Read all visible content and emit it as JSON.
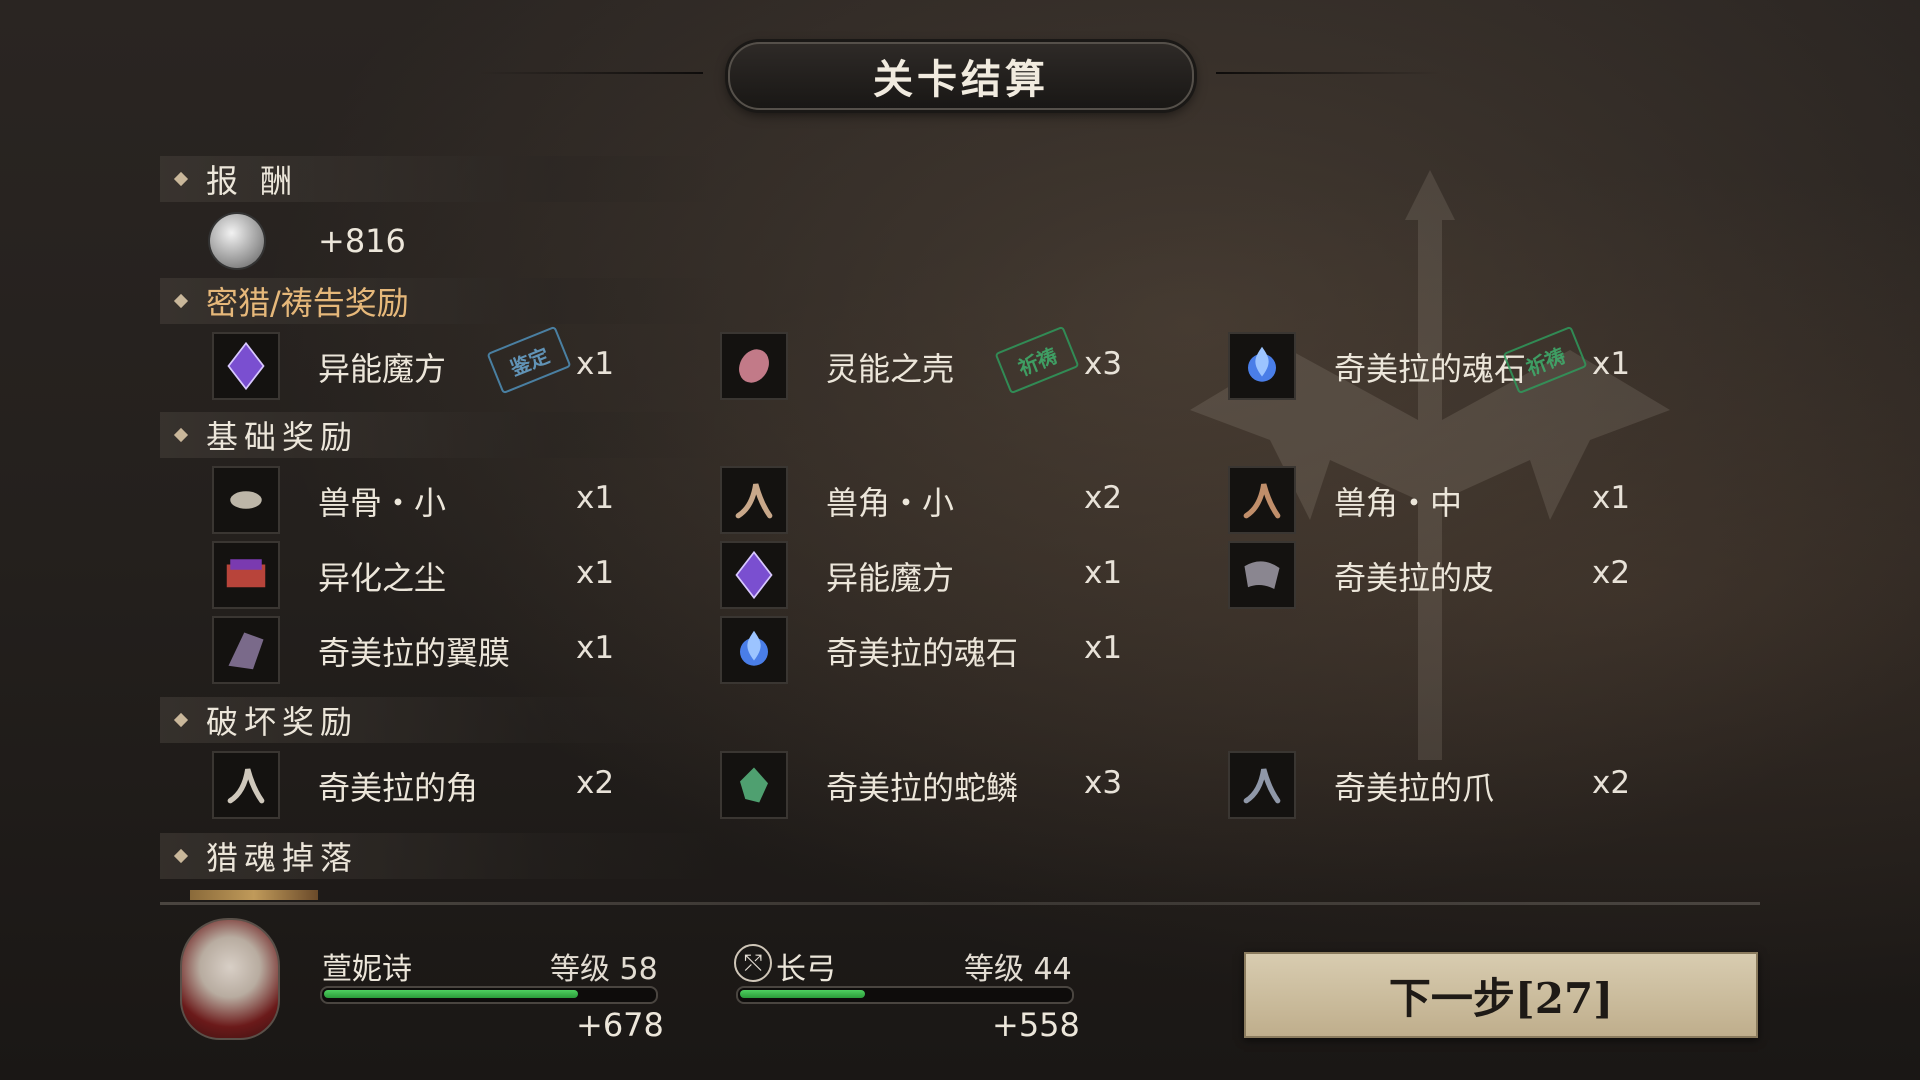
{
  "title": "关卡结算",
  "sections": {
    "reward": {
      "title": "报 酬",
      "coin": "+816"
    },
    "hunt_prayer": {
      "title": "密猎/祷告奖励",
      "items": [
        {
          "name": "异能魔方",
          "qty": "x1",
          "stamp": "鉴定",
          "icon": "purple-crystal-icon",
          "color": "#7a4fd0"
        },
        {
          "name": "灵能之壳",
          "qty": "x3",
          "stamp": "祈祷",
          "icon": "psychic-shell-icon",
          "color": "#c27a88"
        },
        {
          "name": "奇美拉的魂石",
          "qty": "x1",
          "stamp": "祈祷",
          "icon": "blue-soul-stone-icon",
          "color": "#4a7ee8"
        }
      ]
    },
    "basic": {
      "title": "基础奖励",
      "items": [
        {
          "name": "兽骨・小",
          "qty": "x1",
          "icon": "beast-bone-icon",
          "color": "#bdb6a8"
        },
        {
          "name": "兽角・小",
          "qty": "x2",
          "icon": "small-horn-icon",
          "color": "#c9a88a"
        },
        {
          "name": "兽角・中",
          "qty": "x1",
          "icon": "medium-horn-icon",
          "color": "#c08e6a"
        },
        {
          "name": "异化之尘",
          "qty": "x1",
          "icon": "mutation-dust-chest-icon",
          "color": "#b8443a"
        },
        {
          "name": "异能魔方",
          "qty": "x1",
          "icon": "purple-crystal-icon",
          "color": "#7a4fd0"
        },
        {
          "name": "奇美拉的皮",
          "qty": "x2",
          "icon": "chimera-hide-icon",
          "color": "#8a8690"
        },
        {
          "name": "奇美拉的翼膜",
          "qty": "x1",
          "icon": "chimera-wing-icon",
          "color": "#7a6a8a"
        },
        {
          "name": "奇美拉的魂石",
          "qty": "x1",
          "icon": "blue-soul-stone-icon",
          "color": "#4a7ee8"
        }
      ]
    },
    "destruction": {
      "title": "破坏奖励",
      "items": [
        {
          "name": "奇美拉的角",
          "qty": "x2",
          "icon": "chimera-horn-icon",
          "color": "#cfc8bc"
        },
        {
          "name": "奇美拉的蛇鳞",
          "qty": "x3",
          "icon": "chimera-scale-icon",
          "color": "#4fa070"
        },
        {
          "name": "奇美拉的爪",
          "qty": "x2",
          "icon": "chimera-claw-icon",
          "color": "#8f97a8"
        }
      ]
    },
    "soul_drop": {
      "title": "猎魂掉落"
    }
  },
  "character": {
    "name": "萱妮诗",
    "level": "等级 58",
    "exp_gain": "+678",
    "exp_progress": 0.77
  },
  "weapon": {
    "name": "长弓",
    "level": "等级 44",
    "exp_gain": "+558",
    "exp_progress": 0.38
  },
  "next_button": {
    "label": "下一步[27]"
  }
}
